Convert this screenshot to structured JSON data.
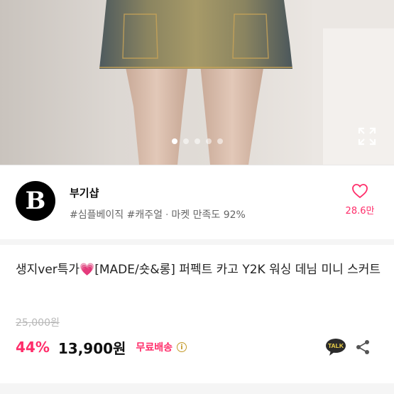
{
  "gallery": {
    "image_icon": "denim-mini-skirt-photo",
    "page_count": 5,
    "active_index": 0,
    "expand_icon": "expand-icon"
  },
  "store": {
    "logo_letter": "B",
    "name": "부기샵",
    "tags": [
      "#심플베이직",
      "#캐주얼"
    ],
    "separator": "·",
    "satisfaction": "마켓 만족도 92%",
    "like_icon": "heart-outline-icon",
    "like_count": "28.6만"
  },
  "product": {
    "title_prefix": "생지ver특가",
    "title_emoji": "💗",
    "title_rest": "[MADE/숏&롱] 퍼펙트 카고 Y2K 워싱 데님 미니 스커트",
    "original_price": "25,000원",
    "discount": "44%",
    "price": "13,900원",
    "shipping": "무료배송",
    "info_icon": "info-icon",
    "talk_label": "TALK",
    "share_icon": "share-icon"
  },
  "colors": {
    "accent": "#ff2d6a",
    "talk_bubble": "#2b2b2b"
  }
}
